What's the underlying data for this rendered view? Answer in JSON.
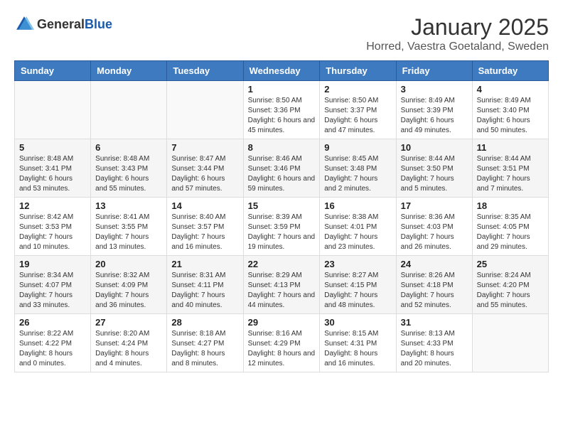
{
  "header": {
    "logo_general": "General",
    "logo_blue": "Blue",
    "title": "January 2025",
    "subtitle": "Horred, Vaestra Goetaland, Sweden"
  },
  "days_of_week": [
    "Sunday",
    "Monday",
    "Tuesday",
    "Wednesday",
    "Thursday",
    "Friday",
    "Saturday"
  ],
  "weeks": [
    [
      {
        "day": "",
        "sunrise": "",
        "sunset": "",
        "daylight": ""
      },
      {
        "day": "",
        "sunrise": "",
        "sunset": "",
        "daylight": ""
      },
      {
        "day": "",
        "sunrise": "",
        "sunset": "",
        "daylight": ""
      },
      {
        "day": "1",
        "sunrise": "Sunrise: 8:50 AM",
        "sunset": "Sunset: 3:36 PM",
        "daylight": "Daylight: 6 hours and 45 minutes."
      },
      {
        "day": "2",
        "sunrise": "Sunrise: 8:50 AM",
        "sunset": "Sunset: 3:37 PM",
        "daylight": "Daylight: 6 hours and 47 minutes."
      },
      {
        "day": "3",
        "sunrise": "Sunrise: 8:49 AM",
        "sunset": "Sunset: 3:39 PM",
        "daylight": "Daylight: 6 hours and 49 minutes."
      },
      {
        "day": "4",
        "sunrise": "Sunrise: 8:49 AM",
        "sunset": "Sunset: 3:40 PM",
        "daylight": "Daylight: 6 hours and 50 minutes."
      }
    ],
    [
      {
        "day": "5",
        "sunrise": "Sunrise: 8:48 AM",
        "sunset": "Sunset: 3:41 PM",
        "daylight": "Daylight: 6 hours and 53 minutes."
      },
      {
        "day": "6",
        "sunrise": "Sunrise: 8:48 AM",
        "sunset": "Sunset: 3:43 PM",
        "daylight": "Daylight: 6 hours and 55 minutes."
      },
      {
        "day": "7",
        "sunrise": "Sunrise: 8:47 AM",
        "sunset": "Sunset: 3:44 PM",
        "daylight": "Daylight: 6 hours and 57 minutes."
      },
      {
        "day": "8",
        "sunrise": "Sunrise: 8:46 AM",
        "sunset": "Sunset: 3:46 PM",
        "daylight": "Daylight: 6 hours and 59 minutes."
      },
      {
        "day": "9",
        "sunrise": "Sunrise: 8:45 AM",
        "sunset": "Sunset: 3:48 PM",
        "daylight": "Daylight: 7 hours and 2 minutes."
      },
      {
        "day": "10",
        "sunrise": "Sunrise: 8:44 AM",
        "sunset": "Sunset: 3:50 PM",
        "daylight": "Daylight: 7 hours and 5 minutes."
      },
      {
        "day": "11",
        "sunrise": "Sunrise: 8:44 AM",
        "sunset": "Sunset: 3:51 PM",
        "daylight": "Daylight: 7 hours and 7 minutes."
      }
    ],
    [
      {
        "day": "12",
        "sunrise": "Sunrise: 8:42 AM",
        "sunset": "Sunset: 3:53 PM",
        "daylight": "Daylight: 7 hours and 10 minutes."
      },
      {
        "day": "13",
        "sunrise": "Sunrise: 8:41 AM",
        "sunset": "Sunset: 3:55 PM",
        "daylight": "Daylight: 7 hours and 13 minutes."
      },
      {
        "day": "14",
        "sunrise": "Sunrise: 8:40 AM",
        "sunset": "Sunset: 3:57 PM",
        "daylight": "Daylight: 7 hours and 16 minutes."
      },
      {
        "day": "15",
        "sunrise": "Sunrise: 8:39 AM",
        "sunset": "Sunset: 3:59 PM",
        "daylight": "Daylight: 7 hours and 19 minutes."
      },
      {
        "day": "16",
        "sunrise": "Sunrise: 8:38 AM",
        "sunset": "Sunset: 4:01 PM",
        "daylight": "Daylight: 7 hours and 23 minutes."
      },
      {
        "day": "17",
        "sunrise": "Sunrise: 8:36 AM",
        "sunset": "Sunset: 4:03 PM",
        "daylight": "Daylight: 7 hours and 26 minutes."
      },
      {
        "day": "18",
        "sunrise": "Sunrise: 8:35 AM",
        "sunset": "Sunset: 4:05 PM",
        "daylight": "Daylight: 7 hours and 29 minutes."
      }
    ],
    [
      {
        "day": "19",
        "sunrise": "Sunrise: 8:34 AM",
        "sunset": "Sunset: 4:07 PM",
        "daylight": "Daylight: 7 hours and 33 minutes."
      },
      {
        "day": "20",
        "sunrise": "Sunrise: 8:32 AM",
        "sunset": "Sunset: 4:09 PM",
        "daylight": "Daylight: 7 hours and 36 minutes."
      },
      {
        "day": "21",
        "sunrise": "Sunrise: 8:31 AM",
        "sunset": "Sunset: 4:11 PM",
        "daylight": "Daylight: 7 hours and 40 minutes."
      },
      {
        "day": "22",
        "sunrise": "Sunrise: 8:29 AM",
        "sunset": "Sunset: 4:13 PM",
        "daylight": "Daylight: 7 hours and 44 minutes."
      },
      {
        "day": "23",
        "sunrise": "Sunrise: 8:27 AM",
        "sunset": "Sunset: 4:15 PM",
        "daylight": "Daylight: 7 hours and 48 minutes."
      },
      {
        "day": "24",
        "sunrise": "Sunrise: 8:26 AM",
        "sunset": "Sunset: 4:18 PM",
        "daylight": "Daylight: 7 hours and 52 minutes."
      },
      {
        "day": "25",
        "sunrise": "Sunrise: 8:24 AM",
        "sunset": "Sunset: 4:20 PM",
        "daylight": "Daylight: 7 hours and 55 minutes."
      }
    ],
    [
      {
        "day": "26",
        "sunrise": "Sunrise: 8:22 AM",
        "sunset": "Sunset: 4:22 PM",
        "daylight": "Daylight: 8 hours and 0 minutes."
      },
      {
        "day": "27",
        "sunrise": "Sunrise: 8:20 AM",
        "sunset": "Sunset: 4:24 PM",
        "daylight": "Daylight: 8 hours and 4 minutes."
      },
      {
        "day": "28",
        "sunrise": "Sunrise: 8:18 AM",
        "sunset": "Sunset: 4:27 PM",
        "daylight": "Daylight: 8 hours and 8 minutes."
      },
      {
        "day": "29",
        "sunrise": "Sunrise: 8:16 AM",
        "sunset": "Sunset: 4:29 PM",
        "daylight": "Daylight: 8 hours and 12 minutes."
      },
      {
        "day": "30",
        "sunrise": "Sunrise: 8:15 AM",
        "sunset": "Sunset: 4:31 PM",
        "daylight": "Daylight: 8 hours and 16 minutes."
      },
      {
        "day": "31",
        "sunrise": "Sunrise: 8:13 AM",
        "sunset": "Sunset: 4:33 PM",
        "daylight": "Daylight: 8 hours and 20 minutes."
      },
      {
        "day": "",
        "sunrise": "",
        "sunset": "",
        "daylight": ""
      }
    ]
  ]
}
